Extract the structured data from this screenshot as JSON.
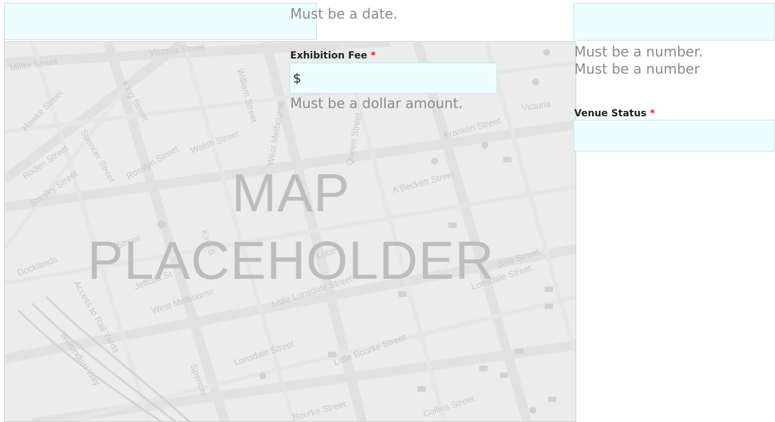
{
  "date_field": {
    "error": "Must be a date."
  },
  "exhibition_fee": {
    "label": "Exhibition Fee",
    "required_mark": "*",
    "prefix": "$",
    "error": "Must be a dollar amount."
  },
  "right_column": {
    "error_number_1": "Must be a number.",
    "error_number_2": "Must be a number"
  },
  "venue_status": {
    "label": "Venue Status",
    "required_mark": "*"
  },
  "map": {
    "line1": "MAP",
    "line2": "PLACEHOLDER",
    "streets": {
      "miller": "Miller Street",
      "victoria": "Victoria Street",
      "victoria_right": "Victoria",
      "king": "King Street",
      "king2": "King S",
      "william": "William Street",
      "hawke": "Hawke Street",
      "roden": "Roden Street",
      "stanley": "Stanley Street",
      "rosslyn": "Rosslyn Street",
      "walsh": "Walsh Street",
      "spencer": "Spencer Street",
      "spencer2": "Spencer",
      "west_melbourne": "West Melbourne",
      "queen": "Queen Street",
      "franklin": "Franklin Street",
      "abeckett": "A'Beckett Street",
      "docklands": "Docklands",
      "jeffcott": "Jeffcott St",
      "dudley": "Street",
      "lonsdale_little": "Little Lonsdale Street",
      "lonsdale": "Lonsdale Street",
      "lonsdale_right": "Lonsdale Street",
      "little_bourke": "Little Bourke Street",
      "bourke": "Bourke Street",
      "collins": "Collins Street",
      "rail": "Access to Rail Yards",
      "wurundjeri": "Wurundjeri Way",
      "west_melb2": "West Melbourne",
      "lobe": "Lobe",
      "dale": "dale Street"
    }
  }
}
